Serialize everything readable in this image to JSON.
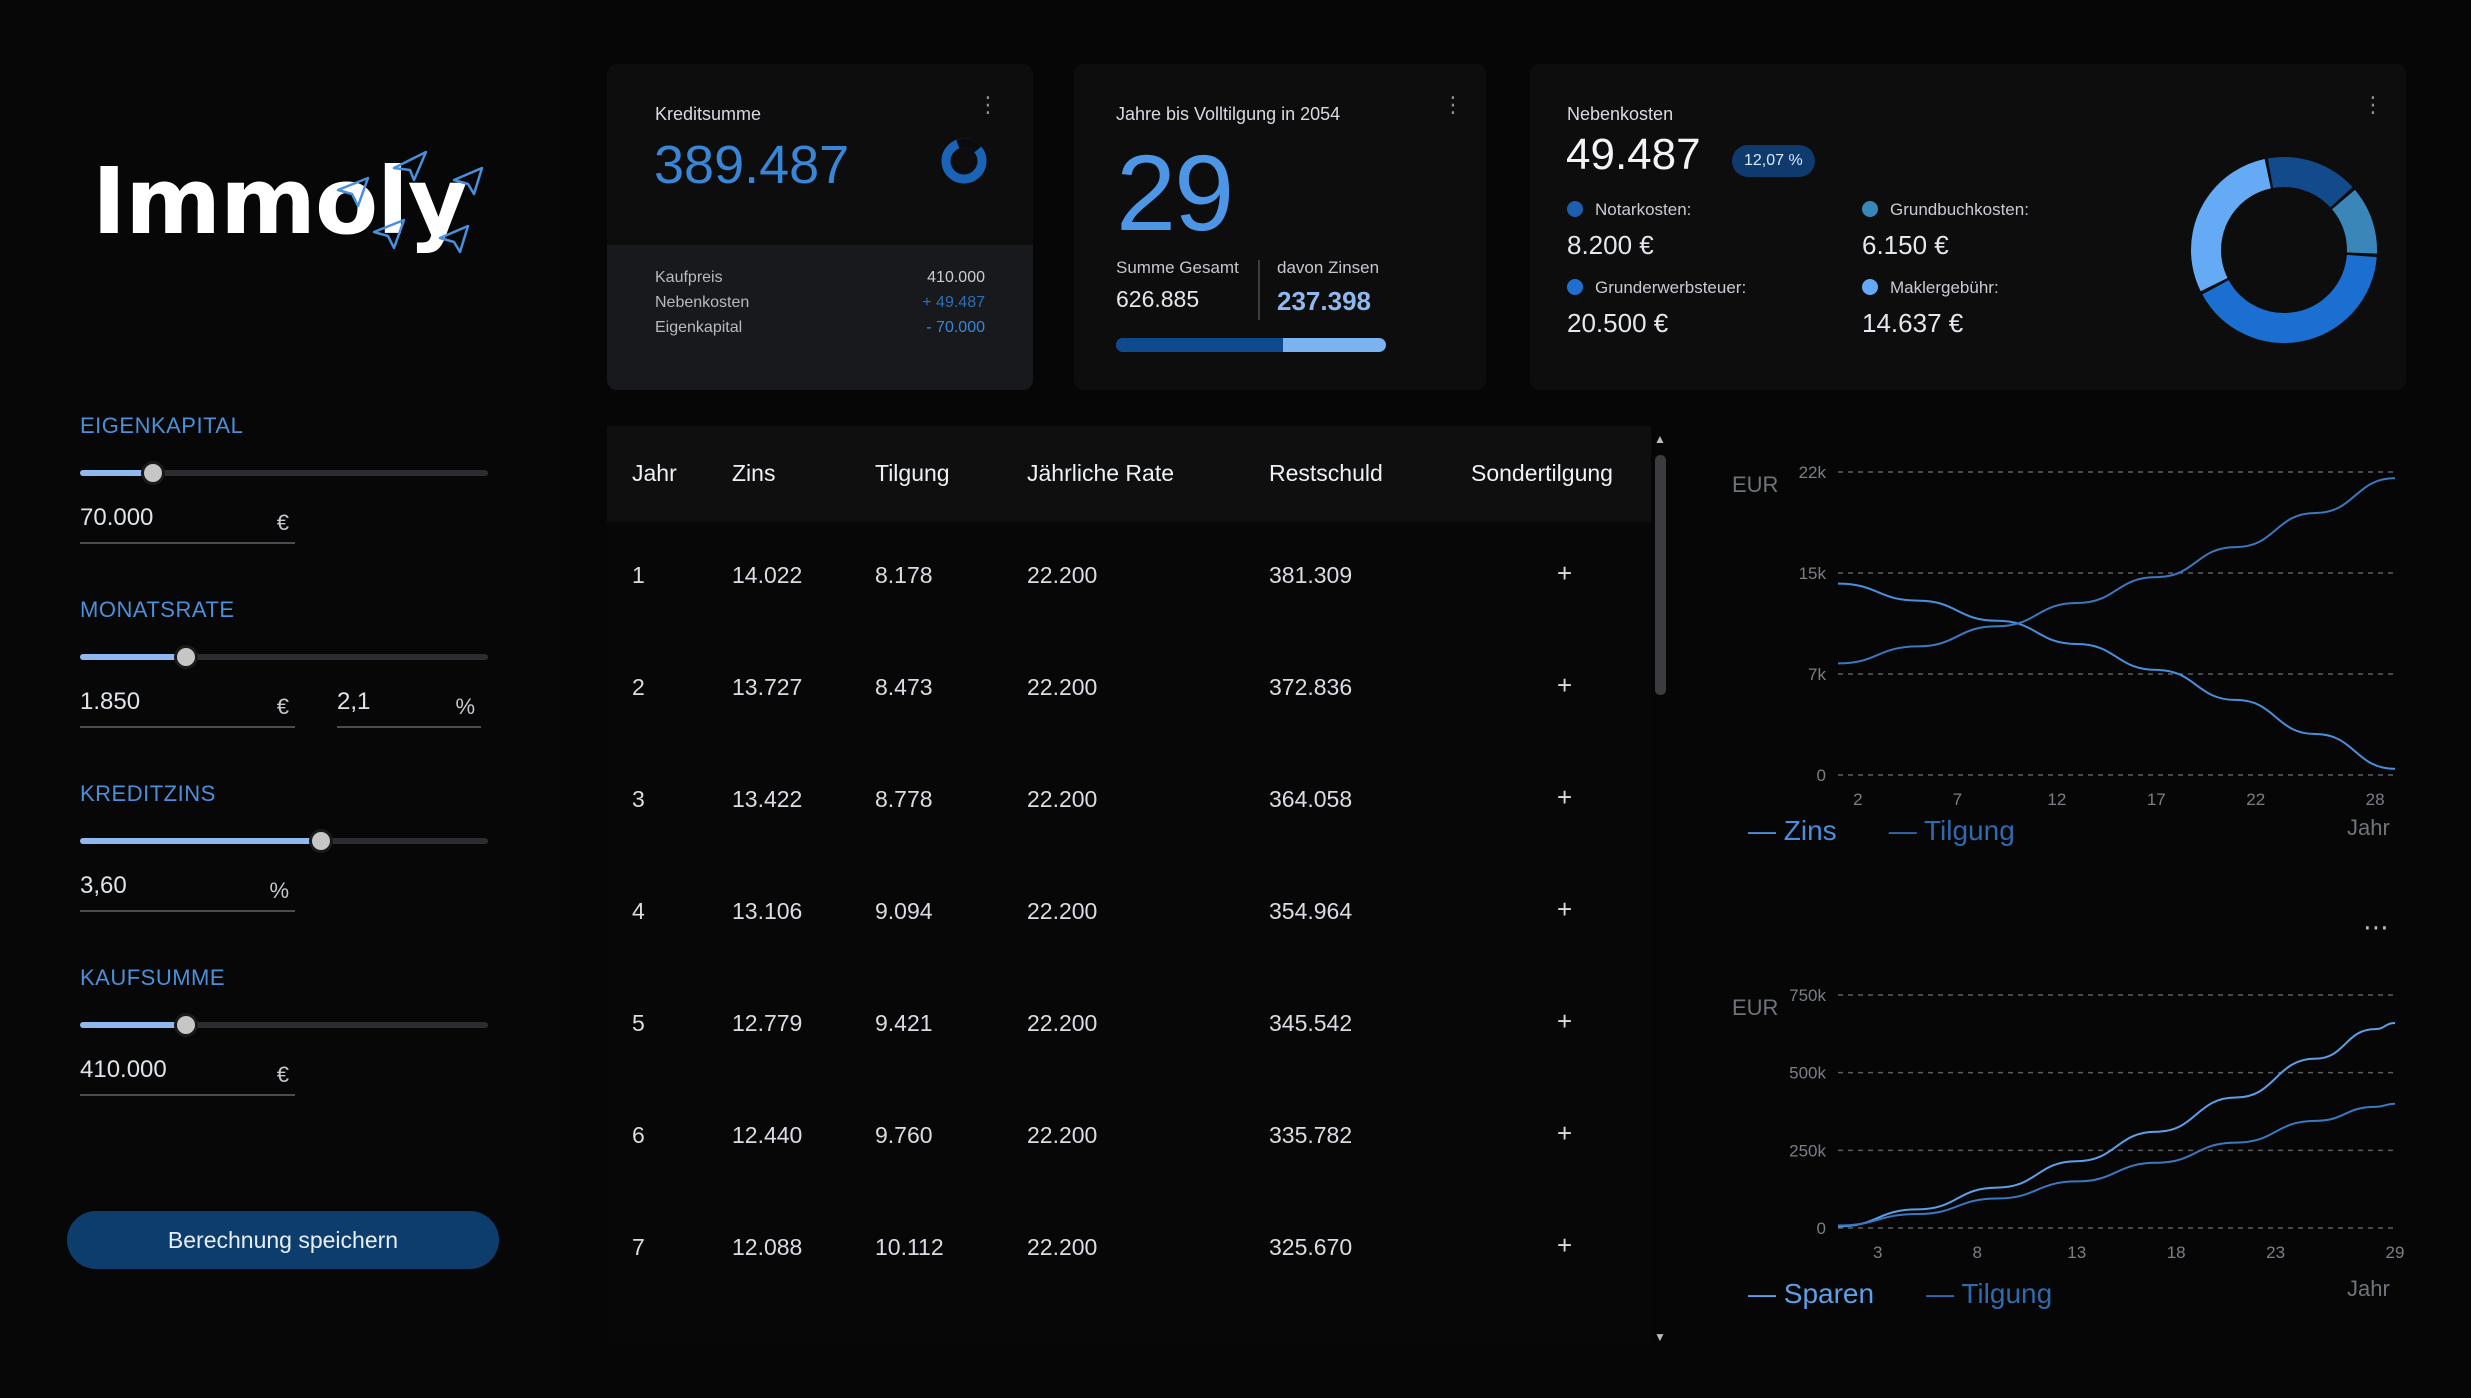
{
  "app": {
    "logo": "Immoly",
    "save_button": "Berechnung speichern"
  },
  "inputs": {
    "eigenkapital": {
      "label": "EIGENKAPITAL",
      "value": "70.000",
      "unit": "€",
      "slider_fraction": 0.18
    },
    "monatsrate": {
      "label": "MONATSRATE",
      "value": "1.850",
      "unit": "€",
      "pct_value": "2,1",
      "pct_unit": "%",
      "slider_fraction": 0.26
    },
    "kreditzins": {
      "label": "KREDITZINS",
      "value": "3,60",
      "unit": "%",
      "slider_fraction": 0.59
    },
    "kaufsumme": {
      "label": "KAUFSUMME",
      "value": "410.000",
      "unit": "€",
      "slider_fraction": 0.26
    }
  },
  "card_kredit": {
    "title": "Kreditsumme",
    "value": "389.487",
    "rows": [
      {
        "label": "Kaufpreis",
        "value": "410.000"
      },
      {
        "label": "Nebenkosten",
        "value": "+ 49.487"
      },
      {
        "label": "Eigenkapital",
        "value": "- 70.000"
      }
    ]
  },
  "card_jahre": {
    "title": "Jahre bis Volltilgung in 2054",
    "value": "29",
    "summe_label": "Summe Gesamt",
    "summe_value": "626.885",
    "zinsen_label": "davon Zinsen",
    "zinsen_value": "237.398",
    "progress_fraction": 0.62
  },
  "card_neben": {
    "title": "Nebenkosten",
    "value": "49.487",
    "badge": "12,07 %",
    "items": [
      {
        "label": "Notarkosten:",
        "value": "8.200 €",
        "color": "#1b5fae"
      },
      {
        "label": "Grundbuchkosten:",
        "value": "6.150 €",
        "color": "#3a86b8"
      },
      {
        "label": "Grunderwerbsteuer:",
        "value": "20.500 €",
        "color": "#1f6fd1"
      },
      {
        "label": "Maklergebühr:",
        "value": "14.637 €",
        "color": "#64a9f5"
      }
    ],
    "donut": [
      {
        "value": 8200,
        "color": "#124a8c"
      },
      {
        "value": 6150,
        "color": "#3a86b8"
      },
      {
        "value": 20500,
        "color": "#1a6fd0"
      },
      {
        "value": 14637,
        "color": "#64aaf5"
      }
    ]
  },
  "table": {
    "headers": [
      "Jahr",
      "Zins",
      "Tilgung",
      "Jährliche Rate",
      "Restschuld",
      "Sondertilgung"
    ],
    "rows": [
      [
        "1",
        "14.022",
        "8.178",
        "22.200",
        "381.309",
        "+"
      ],
      [
        "2",
        "13.727",
        "8.473",
        "22.200",
        "372.836",
        "+"
      ],
      [
        "3",
        "13.422",
        "8.778",
        "22.200",
        "364.058",
        "+"
      ],
      [
        "4",
        "13.106",
        "9.094",
        "22.200",
        "354.964",
        "+"
      ],
      [
        "5",
        "12.779",
        "9.421",
        "22.200",
        "345.542",
        "+"
      ],
      [
        "6",
        "12.440",
        "9.760",
        "22.200",
        "335.782",
        "+"
      ],
      [
        "7",
        "12.088",
        "10.112",
        "22.200",
        "325.670",
        "+"
      ]
    ]
  },
  "chart_data": [
    {
      "type": "line",
      "xlabel": "Jahr",
      "ylabel": "EUR",
      "x_ticks": [
        "2",
        "7",
        "12",
        "17",
        "22",
        "28"
      ],
      "y_ticks": [
        "0",
        "7k",
        "15k",
        "22k"
      ],
      "xlim": [
        1,
        29
      ],
      "ylim": [
        0,
        22200
      ],
      "grid": true,
      "legend": "bottom-left",
      "series": [
        {
          "name": "Zins",
          "color": "#4a8fdc",
          "x": [
            1,
            5,
            9,
            13,
            17,
            21,
            25,
            29
          ],
          "values": [
            14022,
            12779,
            11300,
            9600,
            7700,
            5500,
            3000,
            450
          ]
        },
        {
          "name": "Tilgung",
          "color": "#3d78bf",
          "x": [
            1,
            5,
            9,
            13,
            17,
            21,
            25,
            29
          ],
          "values": [
            8178,
            9421,
            10900,
            12600,
            14500,
            16700,
            19200,
            21750
          ]
        }
      ]
    },
    {
      "type": "line",
      "xlabel": "Jahr",
      "ylabel": "EUR",
      "x_ticks": [
        "3",
        "8",
        "13",
        "18",
        "23",
        "29"
      ],
      "y_ticks": [
        "0",
        "250k",
        "500k",
        "750k"
      ],
      "xlim": [
        1,
        29
      ],
      "ylim": [
        0,
        750000
      ],
      "grid": true,
      "legend": "bottom-left",
      "series": [
        {
          "name": "Sparen",
          "color": "#5d9fe8",
          "x": [
            1,
            5,
            9,
            13,
            17,
            21,
            25,
            28,
            29
          ],
          "values": [
            5000,
            60000,
            130000,
            215000,
            310000,
            420000,
            545000,
            640000,
            660000
          ]
        },
        {
          "name": "Tilgung",
          "color": "#3a78c2",
          "x": [
            1,
            5,
            9,
            13,
            17,
            21,
            25,
            28,
            29
          ],
          "values": [
            8000,
            45000,
            95000,
            150000,
            210000,
            275000,
            345000,
            390000,
            400000
          ]
        }
      ]
    }
  ]
}
